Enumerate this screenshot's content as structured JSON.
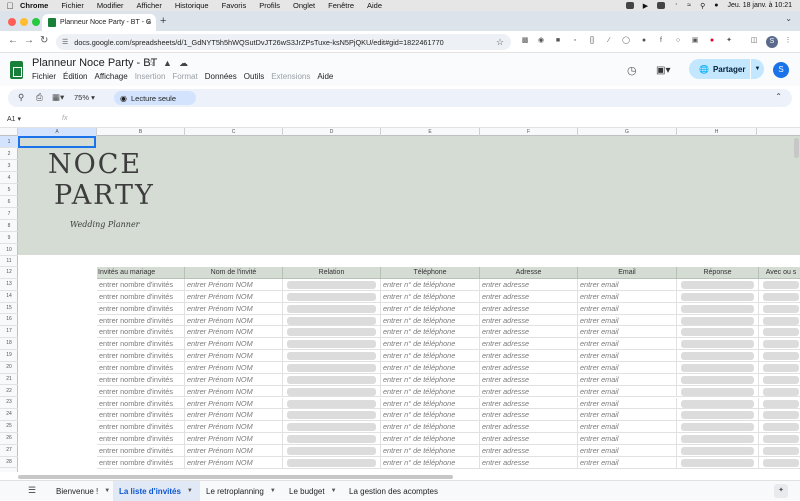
{
  "menubar": {
    "app": "Chrome",
    "items": [
      "Fichier",
      "Modifier",
      "Afficher",
      "Historique",
      "Favoris",
      "Profils",
      "Onglet",
      "Fenêtre",
      "Aide"
    ],
    "datetime": "Jeu. 18 janv. à 10:21"
  },
  "browser": {
    "tab_title": "Planneur Noce Party - BT - G",
    "url": "docs.google.com/spreadsheets/d/1_GdNYT5h5hWQSutDvJT26wS3JrZPsTuxe-ksN5PjQKU/edit#gid=1822461770",
    "profile_letter": "S"
  },
  "sheets": {
    "doc_title": "Planneur Noce Party - BT",
    "menus": [
      "Fichier",
      "Édition",
      "Affichage",
      "Insertion",
      "Format",
      "Données",
      "Outils",
      "Extensions",
      "Aide"
    ],
    "disabled_menus": [
      "Insertion",
      "Format",
      "Extensions"
    ],
    "share_label": "Partager",
    "avatar_letter": "S",
    "zoom": "75%",
    "readonly_label": "Lecture seule",
    "name_box": "A1",
    "fx": "fx"
  },
  "grid": {
    "columns": [
      "A",
      "B",
      "C",
      "D",
      "E",
      "F",
      "G",
      "H"
    ],
    "row_numbers": [
      "1",
      "2",
      "3",
      "4",
      "5",
      "6",
      "7",
      "8",
      "9",
      "10",
      "11",
      "12",
      "13",
      "14",
      "15",
      "16",
      "17",
      "18",
      "19",
      "20",
      "21",
      "22",
      "23",
      "24",
      "25",
      "26",
      "27",
      "28"
    ],
    "banner": {
      "line1": "NOCE",
      "line2": "PARTY",
      "line3": "Wedding Planner"
    },
    "table": {
      "headers": [
        "Invités au mariage",
        "Nom de l'invité",
        "Relation",
        "Téléphone",
        "Adresse",
        "Email",
        "Réponse",
        "Avec ou s"
      ],
      "row_template": {
        "invites": "entrer nombre d'invités",
        "nom": "entrer Prénom NOM",
        "telephone": "entrer n° de téléphone",
        "adresse": "entrer adresse",
        "email": "entrer email"
      },
      "row_count": 16
    }
  },
  "sheet_tabs": [
    {
      "label": "Bienvenue !",
      "active": false
    },
    {
      "label": "La liste d'invités",
      "active": true
    },
    {
      "label": "Le retroplanning",
      "active": false
    },
    {
      "label": "Le budget",
      "active": false
    },
    {
      "label": "La gestion des acomptes",
      "active": false
    }
  ]
}
